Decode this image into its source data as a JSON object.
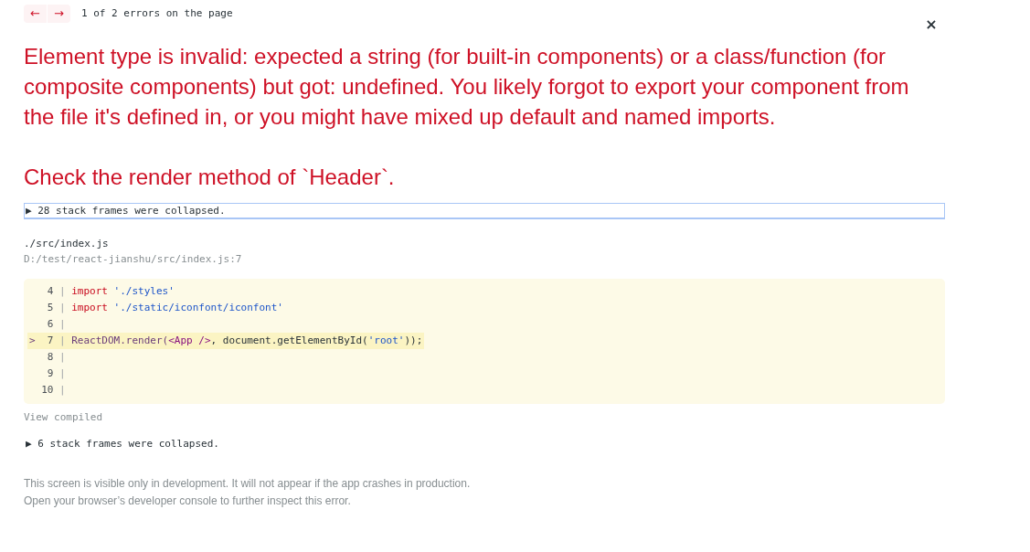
{
  "nav": {
    "prev": "←",
    "next": "→",
    "counter": "1 of 2 errors on the page"
  },
  "close_button": "×",
  "header": [
    "Element type is invalid: expected a string (for built-in components) or a class/function (for composite components) but got: undefined. You likely forgot to export your component from the file it's defined in, or you might have mixed up default and named imports.",
    "Check the render method of `Header`."
  ],
  "stack": [
    {
      "kind": "collapsed",
      "label": "▶ 28 stack frames were collapsed.",
      "focused": true
    },
    {
      "kind": "frame",
      "file": "./src/index.js",
      "location": "D:/test/react-jianshu/src/index.js:7",
      "lines": [
        {
          "number": "4",
          "separator": "|",
          "highlighted": false,
          "tokens": [
            {
              "kind": "keyword",
              "text": "import "
            },
            {
              "kind": "string",
              "text": "'./styles'"
            }
          ]
        },
        {
          "number": "5",
          "separator": "|",
          "highlighted": false,
          "tokens": [
            {
              "kind": "keyword",
              "text": "import "
            },
            {
              "kind": "string",
              "text": "'./static/iconfont/iconfont'"
            }
          ]
        },
        {
          "number": "6",
          "separator": "|",
          "highlighted": false
        },
        {
          "marker": ">",
          "number": "7",
          "separator": "|",
          "highlighted": true,
          "tokens": [
            {
              "kind": "identifier",
              "text": "ReactDOM.render("
            },
            {
              "kind": "jsx",
              "text": "<App />"
            },
            {
              "kind": "plain",
              "text": ", document.getElementById("
            },
            {
              "kind": "string",
              "text": "'root'"
            },
            {
              "kind": "plain",
              "text": "));"
            }
          ]
        },
        {
          "number": "8",
          "separator": "|",
          "highlighted": false
        },
        {
          "number": "9",
          "separator": "|",
          "highlighted": false
        },
        {
          "number": "10",
          "separator": "|",
          "highlighted": false
        }
      ],
      "view_compiled": "View compiled"
    },
    {
      "kind": "collapsed",
      "label": "▶ 6 stack frames were collapsed.",
      "focused": false
    }
  ],
  "footer": [
    "This screen is visible only in development. It will not appear if the app crashes in production.",
    "Open your browser’s developer console to further inspect this error."
  ]
}
